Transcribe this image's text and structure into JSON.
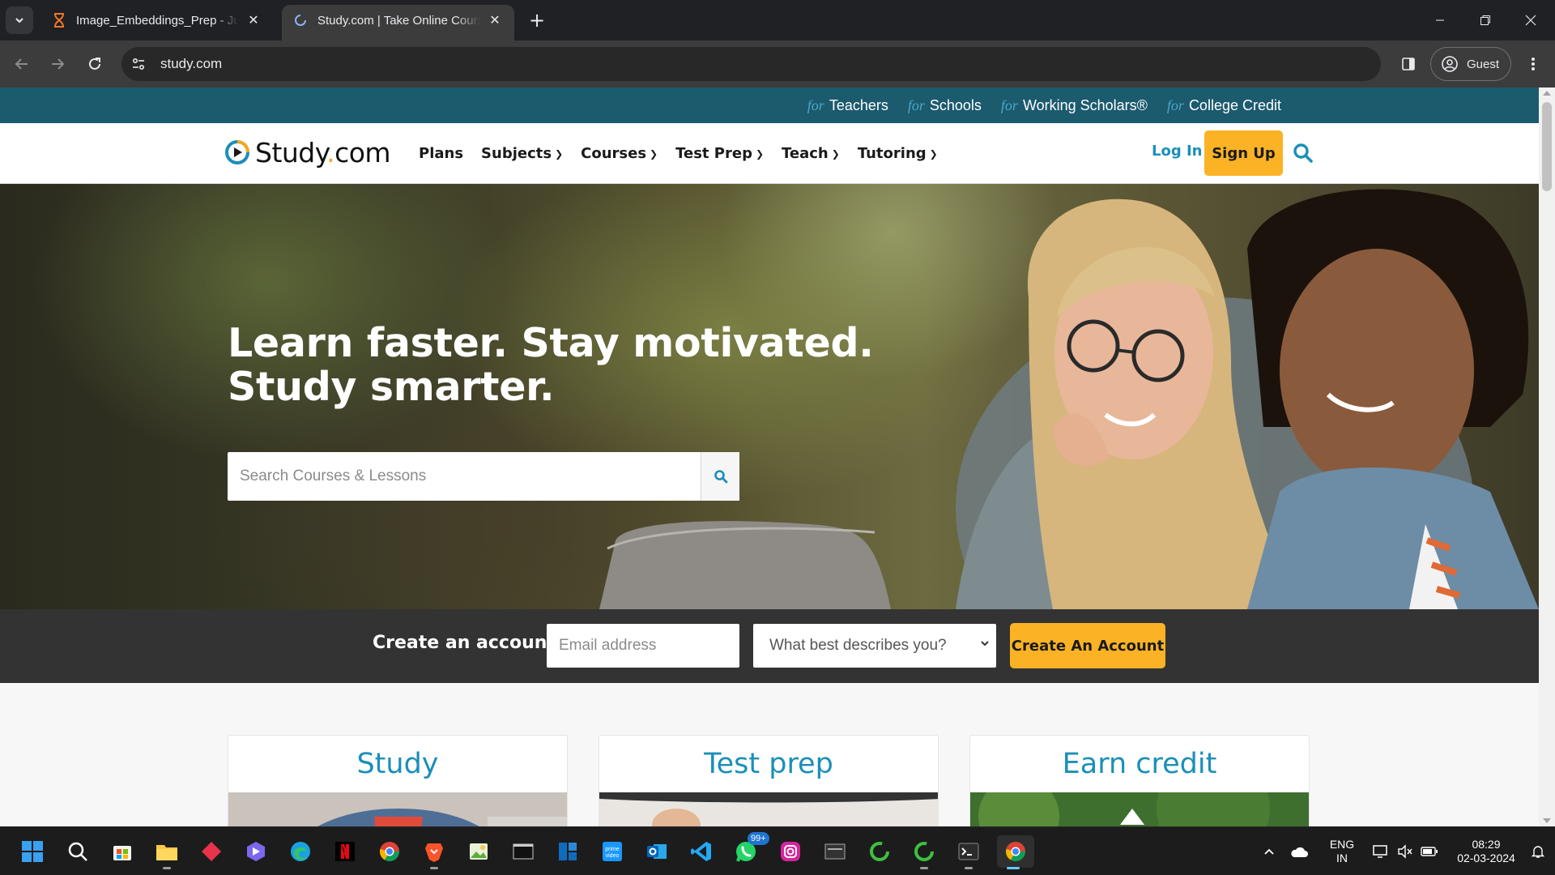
{
  "browser": {
    "tabs": [
      {
        "title": "Image_Embeddings_Prep - Jupyter",
        "active": false,
        "icon": "hourglass-icon"
      },
      {
        "title": "Study.com | Take Online Courses",
        "active": true,
        "icon": "loading-spinner-icon"
      }
    ],
    "url": "study.com",
    "profile_label": "Guest"
  },
  "page": {
    "topstrip": [
      {
        "prefix": "for",
        "label": "Teachers"
      },
      {
        "prefix": "for",
        "label": "Schools"
      },
      {
        "prefix": "for",
        "label": "Working Scholars®"
      },
      {
        "prefix": "for",
        "label": "College Credit"
      }
    ],
    "logo": {
      "text_main": "Study",
      "text_dot": ".",
      "text_tld": "com"
    },
    "nav": [
      {
        "label": "Plans",
        "dropdown": false
      },
      {
        "label": "Subjects",
        "dropdown": true
      },
      {
        "label": "Courses",
        "dropdown": true
      },
      {
        "label": "Test Prep",
        "dropdown": true
      },
      {
        "label": "Teach",
        "dropdown": true
      },
      {
        "label": "Tutoring",
        "dropdown": true
      }
    ],
    "login_label": "Log In",
    "signup_label": "Sign Up",
    "hero": {
      "headline_line1": "Learn faster. Stay motivated.",
      "headline_line2": "Study smarter.",
      "search_placeholder": "Search Courses & Lessons"
    },
    "account": {
      "label": "Create an account",
      "email_placeholder": "Email address",
      "select_value": "What best describes you?",
      "cta_label": "Create An Account"
    },
    "cards": [
      {
        "title": "Study"
      },
      {
        "title": "Test prep"
      },
      {
        "title": "Earn credit"
      }
    ],
    "colors": {
      "accent": "#1b8fb8",
      "cta": "#fbb325",
      "strip": "#1c5a6e",
      "account_bar": "#333333"
    }
  },
  "taskbar": {
    "apps": [
      "windows-start-icon",
      "search-icon",
      "microsoft-store-icon",
      "file-explorer-icon",
      "app-red-diamond-icon",
      "app-purple-icon",
      "edge-icon",
      "netflix-icon",
      "chrome-icon",
      "brave-icon",
      "photo-app-icon",
      "terminal-icon",
      "widget-app-icon",
      "prime-video-icon",
      "outlook-icon",
      "vscode-icon",
      "whatsapp-icon",
      "instagram-icon",
      "window-app-icon",
      "green-ring-icon",
      "green-ring-icon-2",
      "terminal-dark-icon",
      "chrome-active-icon"
    ],
    "whatsapp_badge": "99+",
    "lang_line1": "ENG",
    "lang_line2": "IN",
    "time": "08:29",
    "date": "02-03-2024"
  }
}
